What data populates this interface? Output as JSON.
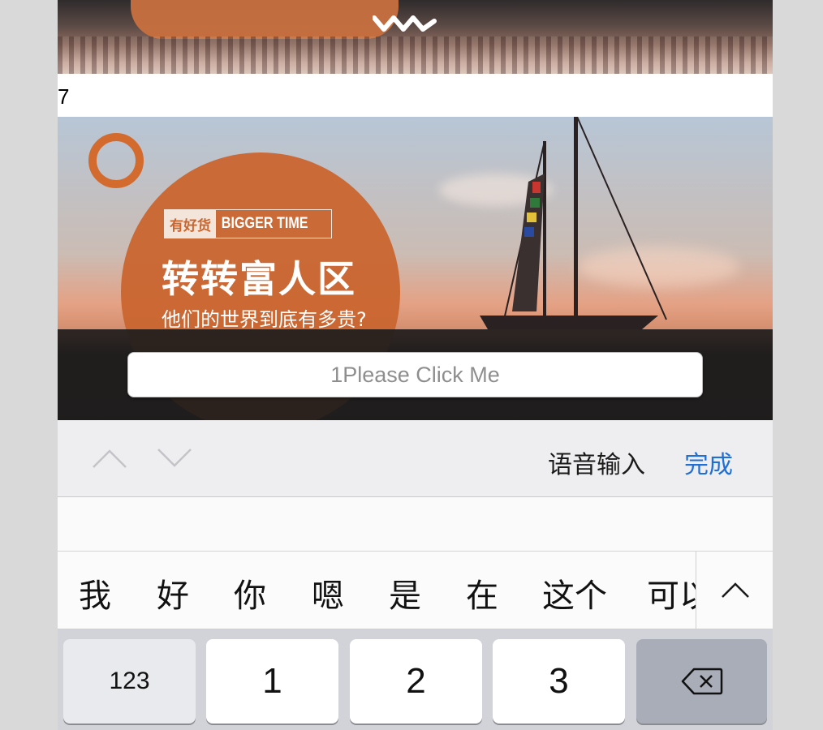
{
  "list": {
    "item_number": "7"
  },
  "banner": {
    "logo_mark": "有好货",
    "logo_text": "BIGGER TIME",
    "headline": "转转富人区",
    "subline": "他们的世界到底有多贵?",
    "button_label": "1Please Click Me",
    "accent_color": "#c9652f"
  },
  "accessory_bar": {
    "prev_icon": "chevron-up-icon",
    "next_icon": "chevron-down-icon",
    "voice_input_label": "语音输入",
    "done_label": "完成",
    "done_color": "#1f6fd6"
  },
  "candidates": {
    "items": [
      "我",
      "好",
      "你",
      "嗯",
      "是",
      "在",
      "这个",
      "可以"
    ],
    "expand_icon": "chevron-up-icon"
  },
  "keys": {
    "mode_label": "123",
    "digit_1": "1",
    "digit_2": "2",
    "digit_3": "3",
    "delete_icon": "backspace-icon"
  }
}
